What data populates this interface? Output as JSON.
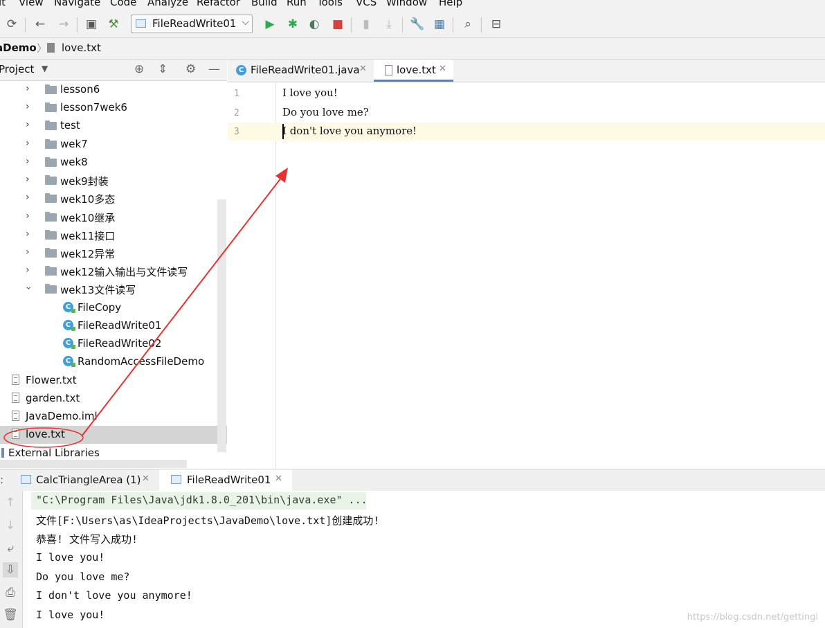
{
  "menu": [
    "it",
    "View",
    "Navigate",
    "Code",
    "Analyze",
    "Refactor",
    "Build",
    "Run",
    "Tools",
    "VCS",
    "Window",
    "Help"
  ],
  "toolbar": {
    "run_config": "FileReadWrite01"
  },
  "breadcrumb": {
    "project": "aDemo",
    "file": "love.txt"
  },
  "project_panel": {
    "title": "Project",
    "items": [
      {
        "label": "lesson6",
        "type": "folder"
      },
      {
        "label": "lesson7wek6",
        "type": "folder"
      },
      {
        "label": "test",
        "type": "folder"
      },
      {
        "label": "wek7",
        "type": "folder"
      },
      {
        "label": "wek8",
        "type": "folder"
      },
      {
        "label": "wek9封装",
        "type": "folder"
      },
      {
        "label": "wek10多态",
        "type": "folder"
      },
      {
        "label": "wek10继承",
        "type": "folder"
      },
      {
        "label": "wek11接口",
        "type": "folder"
      },
      {
        "label": "wek12异常",
        "type": "folder"
      },
      {
        "label": "wek12输入输出与文件读写",
        "type": "folder"
      },
      {
        "label": "wek13文件读写",
        "type": "folder-open"
      },
      {
        "label": "FileCopy",
        "type": "class"
      },
      {
        "label": "FileReadWrite01",
        "type": "class"
      },
      {
        "label": "FileReadWrite02",
        "type": "class"
      },
      {
        "label": "RandomAccessFileDemo",
        "type": "class"
      },
      {
        "label": "Flower.txt",
        "type": "file"
      },
      {
        "label": "garden.txt",
        "type": "file"
      },
      {
        "label": "JavaDemo.iml",
        "type": "file"
      },
      {
        "label": "love.txt",
        "type": "file",
        "selected": true
      }
    ],
    "external_libraries": "External Libraries"
  },
  "editor": {
    "tabs": [
      {
        "label": "FileReadWrite01.java",
        "active": false
      },
      {
        "label": "love.txt",
        "active": true
      }
    ],
    "lines": [
      "I love you!",
      "Do you love me?",
      "I don't love you anymore!"
    ],
    "line_numbers": [
      "1",
      "2",
      "3"
    ],
    "current_line": 3
  },
  "run_panel": {
    "tabs": [
      {
        "label": "CalcTriangleArea (1)"
      },
      {
        "label": "FileReadWrite01"
      }
    ],
    "output": [
      "\"C:\\Program Files\\Java\\jdk1.8.0_201\\bin\\java.exe\" ...",
      "文件[F:\\Users\\as\\IdeaProjects\\JavaDemo\\love.txt]创建成功!",
      "恭喜! 文件写入成功!",
      "I love you!",
      "Do you love me?",
      "I don't love you anymore!",
      "I love you!"
    ]
  },
  "watermark": "https://blog.csdn.net/gettingi",
  "colors": {
    "annotation": "#e8322f",
    "current_line_bg": "#fffae3",
    "selected_row_bg": "#d4d4d4",
    "command_line_bg": "#e8f5e6",
    "run_green": "#2fa84f",
    "stop_red": "#d9403b"
  }
}
